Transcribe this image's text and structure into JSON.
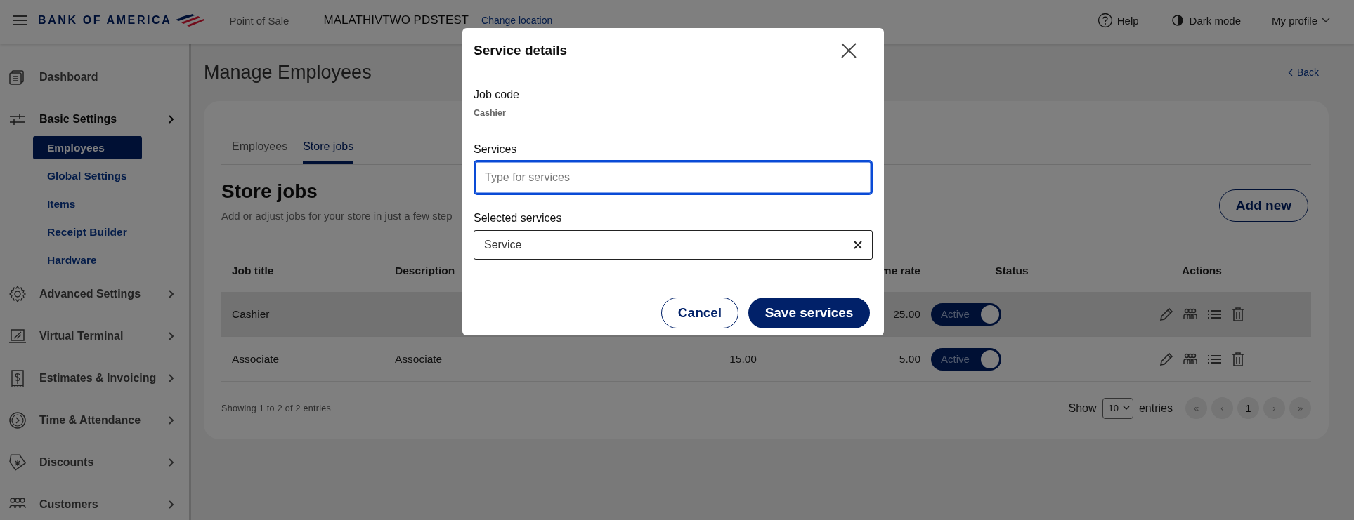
{
  "header": {
    "logo": "BANK OF AMERICA",
    "app": "Point of Sale",
    "store": "MALATHIVTWO PDSTEST",
    "change_link": "Change location",
    "help": "Help",
    "dark_mode": "Dark mode",
    "profile": "My profile"
  },
  "sidebar": {
    "items": [
      {
        "label": "Dashboard",
        "expanded": false
      },
      {
        "label": "Basic Settings",
        "expanded": true,
        "children": [
          {
            "label": "Employees",
            "selected": true
          },
          {
            "label": "Global Settings",
            "selected": false
          },
          {
            "label": "Items",
            "selected": false
          },
          {
            "label": "Receipt Builder",
            "selected": false
          },
          {
            "label": "Hardware",
            "selected": false
          }
        ]
      },
      {
        "label": "Advanced Settings",
        "expanded": false
      },
      {
        "label": "Virtual Terminal",
        "expanded": false
      },
      {
        "label": "Estimates & Invoicing",
        "expanded": false
      },
      {
        "label": "Time & Attendance",
        "expanded": false
      },
      {
        "label": "Discounts",
        "expanded": false
      },
      {
        "label": "Customers",
        "expanded": false
      }
    ]
  },
  "page": {
    "title": "Manage Employees",
    "back": "Back"
  },
  "tabs": [
    {
      "label": "Employees",
      "selected": false
    },
    {
      "label": "Store jobs",
      "selected": true
    }
  ],
  "section": {
    "title": "Store jobs",
    "subtitle": "Add or adjust jobs for your store in just a few step",
    "add_button": "Add new"
  },
  "table": {
    "columns": [
      "Job title",
      "Description",
      "",
      "me rate",
      "Status",
      "Actions"
    ],
    "rows": [
      {
        "cells": [
          "Cashier",
          "",
          "",
          "25.00"
        ],
        "status": "Active",
        "on": true,
        "selected": true
      },
      {
        "cells": [
          "Associate",
          "Associate",
          "15.00",
          "5.00"
        ],
        "status": "Active",
        "on": true,
        "selected": false
      }
    ]
  },
  "footer": {
    "info": "Showing 1 to 2 of 2 entries",
    "show": "Show",
    "page_size": "10",
    "entries": "entries",
    "pages": [
      {
        "label": "«",
        "selected": false
      },
      {
        "label": "‹",
        "selected": false
      },
      {
        "label": "1",
        "selected": true
      },
      {
        "label": "›",
        "selected": false
      },
      {
        "label": "»",
        "selected": false
      }
    ]
  },
  "dialog": {
    "title": "Service details",
    "job_code_label": "Job code",
    "job_code": "Cashier",
    "services_label": "Services",
    "services_placeholder": "Type for services",
    "selected_label": "Selected services",
    "selected": [
      "Service"
    ],
    "cancel": "Cancel",
    "save": "Save services"
  }
}
